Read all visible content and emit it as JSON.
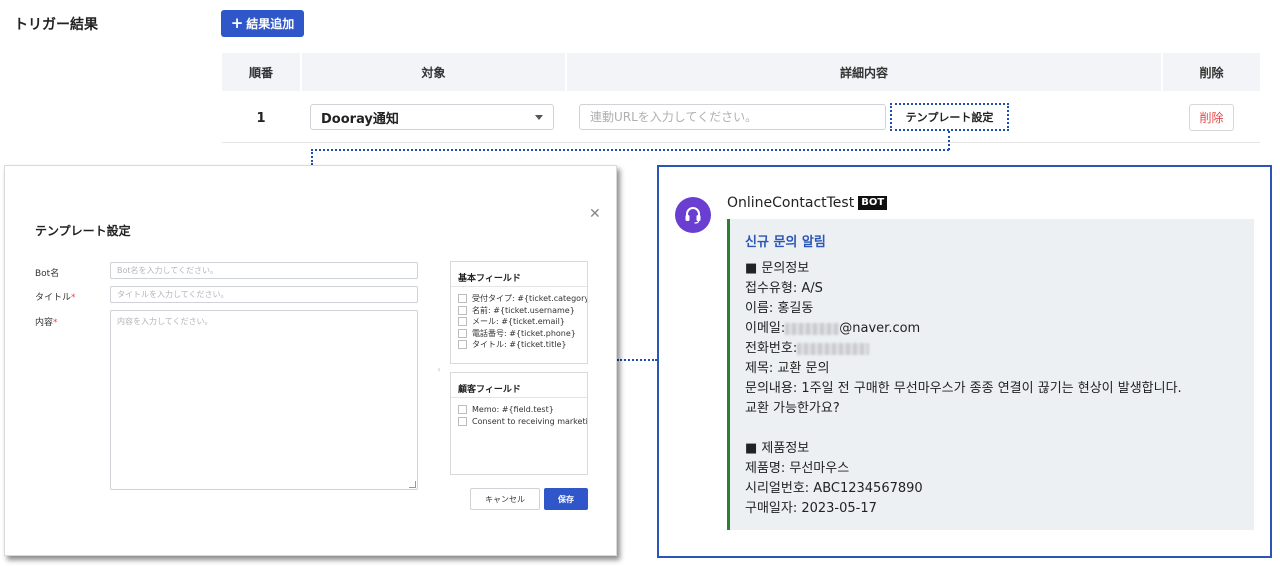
{
  "section": {
    "title": "トリガー結果",
    "add_button": "結果追加"
  },
  "table": {
    "headers": [
      "順番",
      "対象",
      "詳細内容",
      "削除"
    ],
    "row": {
      "no": "1",
      "target": "Dooray通知",
      "url_placeholder": "連動URLを入力してください。",
      "template_button": "テンプレート設定",
      "delete_button": "削除"
    }
  },
  "modal": {
    "title": "テンプレート設定",
    "bot_label": "Bot名",
    "bot_placeholder": "Bot名を入力してください。",
    "title_label": "タイトル",
    "title_placeholder": "タイトルを入力してください。",
    "content_label": "内容",
    "content_placeholder": "内容を入力してください。",
    "required_mark": "*",
    "basic_fields": {
      "title": "基本フィールド",
      "items": [
        "受付タイプ: #{ticket.category}",
        "名前: #{ticket.username}",
        "メール: #{ticket.email}",
        "電話番号: #{ticket.phone}",
        "タイトル: #{ticket.title}"
      ]
    },
    "customer_fields": {
      "title": "顧客フィールド",
      "items": [
        "Memo: #{field.test}",
        "Consent to receiving marketing"
      ]
    },
    "cancel_button": "キャンセル",
    "save_button": "保存"
  },
  "preview": {
    "sender": "OnlineContactTest",
    "badge": "BOT",
    "message_title": "신규 문의 알림",
    "section1_heading": "■ 문의정보",
    "type_line": "접수유형: A/S",
    "name_line": "이름: 홍길동",
    "email_prefix": "이메일: ",
    "email_suffix": "@naver.com",
    "phone_prefix": "전화번호: ",
    "subject_line": "제목: 교환 문의",
    "content_line1": "문의내용: 1주일 전 구매한 무선마우스가 종종 연결이 끊기는 현상이 발생합니다.",
    "content_line2": "교환 가능한가요?",
    "section2_heading": "■ 제품정보",
    "product_line": "제품명: 무선마우스",
    "serial_line": "시리얼번호: ABC1234567890",
    "date_line": "구매일자: 2023-05-17"
  },
  "colors": {
    "primary": "#2f57c9",
    "danger": "#e54848",
    "preview_border": "#2b56b8",
    "avatar": "#6a3ed0",
    "message_accent": "#2e7d32"
  }
}
